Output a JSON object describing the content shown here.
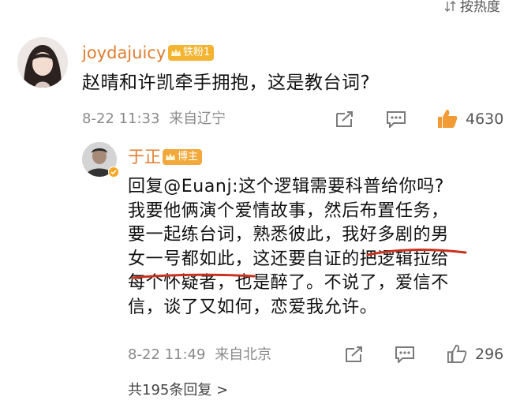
{
  "sort_label": "按热度",
  "comment": {
    "username": "joydajuicy",
    "badge": "铁粉1",
    "text": "赵晴和许凯牵手拥抱，这是教台词?",
    "date": "8-22 11:33",
    "location": "来自辽宁",
    "likes": "4630"
  },
  "reply": {
    "username": "于正",
    "badge": "博主",
    "lines": [
      "回复@Euanj:这个逻辑需要科普给你吗?",
      "我要他俩演个爱情故事，然后布置任务，",
      "要一起练台词，熟悉彼此，我好多剧的男",
      "女一号都如此，这还要自证的把逻辑拉给",
      "每个怀疑者，也是醉了。不说了，爱信不",
      "信，谈了又如何，恋爱我允许。"
    ],
    "date": "8-22 11:49",
    "location": "来自北京",
    "likes": "296"
  },
  "more_replies": "共195条回复 >",
  "colors": {
    "username": "#e07d2f",
    "badge_fan": "#f2b431",
    "badge_blog": "#f2a93b",
    "underline": "#c8321e",
    "meta": "#8a8a8a"
  },
  "icons": [
    "sort-icon",
    "share-icon",
    "comment-icon",
    "like-icon",
    "crown-icon",
    "chevron-right-icon"
  ]
}
